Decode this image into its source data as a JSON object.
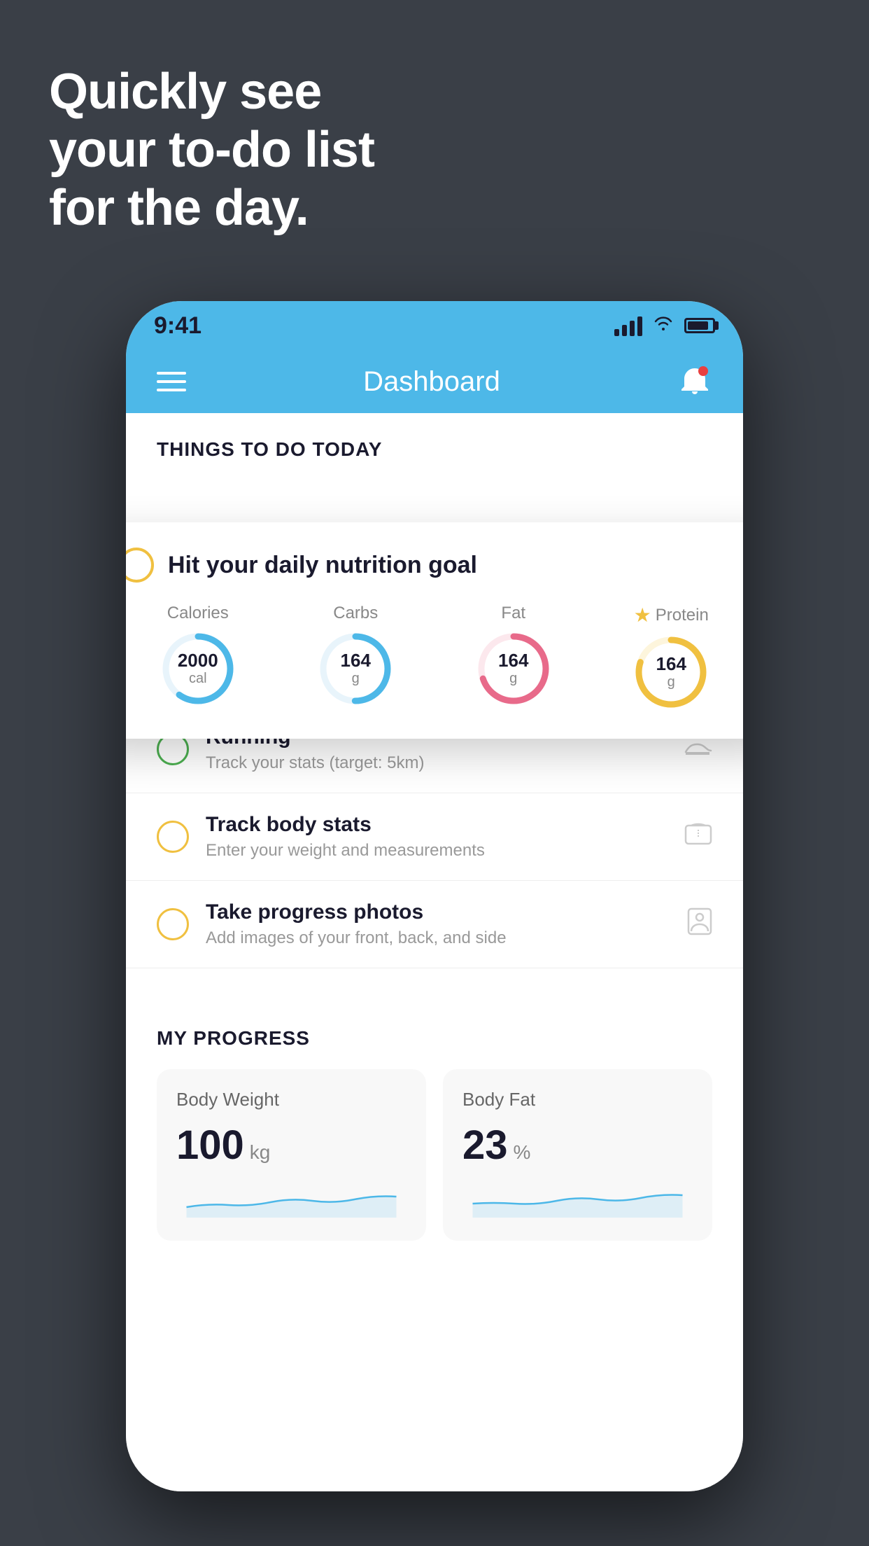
{
  "hero": {
    "line1": "Quickly see",
    "line2": "your to-do list",
    "line3": "for the day."
  },
  "phone": {
    "status_bar": {
      "time": "9:41"
    },
    "nav": {
      "title": "Dashboard"
    },
    "things_section": {
      "header": "THINGS TO DO TODAY"
    },
    "floating_card": {
      "title": "Hit your daily nutrition goal",
      "nutrition": [
        {
          "label": "Calories",
          "value": "2000",
          "unit": "cal",
          "color": "#4db8e8",
          "percent": 60,
          "has_star": false
        },
        {
          "label": "Carbs",
          "value": "164",
          "unit": "g",
          "color": "#4db8e8",
          "percent": 50,
          "has_star": false
        },
        {
          "label": "Fat",
          "value": "164",
          "unit": "g",
          "color": "#e86a8a",
          "percent": 70,
          "has_star": false
        },
        {
          "label": "Protein",
          "value": "164",
          "unit": "g",
          "color": "#f0c040",
          "percent": 80,
          "has_star": true
        }
      ]
    },
    "todo_items": [
      {
        "id": "running",
        "title": "Running",
        "subtitle": "Track your stats (target: 5km)",
        "circle_color": "green",
        "icon": "shoe"
      },
      {
        "id": "body-stats",
        "title": "Track body stats",
        "subtitle": "Enter your weight and measurements",
        "circle_color": "yellow",
        "icon": "scale"
      },
      {
        "id": "progress-photos",
        "title": "Take progress photos",
        "subtitle": "Add images of your front, back, and side",
        "circle_color": "yellow",
        "icon": "person"
      }
    ],
    "progress_section": {
      "header": "MY PROGRESS",
      "cards": [
        {
          "title": "Body Weight",
          "value": "100",
          "unit": "kg"
        },
        {
          "title": "Body Fat",
          "value": "23",
          "unit": "%"
        }
      ]
    }
  }
}
